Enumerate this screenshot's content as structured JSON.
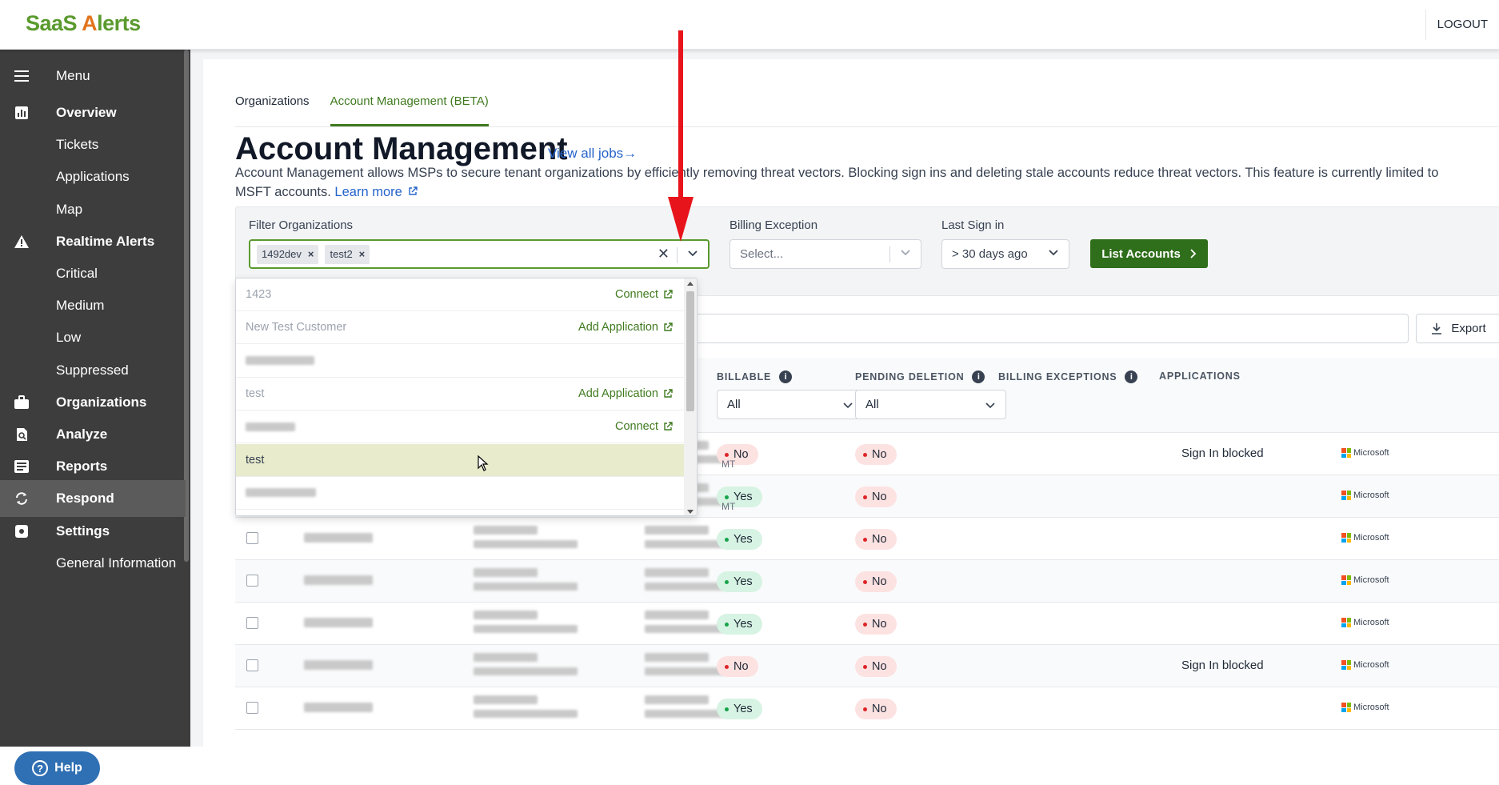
{
  "app": {
    "logo_text": "SaaS Alerts",
    "logo_prefix": "SaaS ",
    "logo_accent": "A",
    "logo_suffix": "lerts",
    "logout": "LOGOUT",
    "brand_color": "#5a9a2e",
    "accent_color": "#3f7a1e"
  },
  "sidebar": {
    "menu": "Menu",
    "items": [
      {
        "label": "Overview",
        "icon": "chart-icon",
        "bold": true
      },
      {
        "label": "Tickets",
        "icon": "",
        "bold": false
      },
      {
        "label": "Applications",
        "icon": "",
        "bold": false
      },
      {
        "label": "Map",
        "icon": "",
        "bold": false
      },
      {
        "label": "Realtime Alerts",
        "icon": "warning-icon",
        "bold": true
      },
      {
        "label": "Critical",
        "icon": "",
        "bold": false
      },
      {
        "label": "Medium",
        "icon": "",
        "bold": false
      },
      {
        "label": "Low",
        "icon": "",
        "bold": false
      },
      {
        "label": "Suppressed",
        "icon": "",
        "bold": false
      },
      {
        "label": "Organizations",
        "icon": "briefcase-icon",
        "bold": true
      },
      {
        "label": "Analyze",
        "icon": "analyze-icon",
        "bold": true
      },
      {
        "label": "Reports",
        "icon": "reports-icon",
        "bold": true
      },
      {
        "label": "Respond",
        "icon": "respond-icon",
        "bold": true,
        "active": true
      },
      {
        "label": "Settings",
        "icon": "gear-icon",
        "bold": true
      },
      {
        "label": "General Information",
        "icon": "",
        "bold": false
      }
    ],
    "help": "Help"
  },
  "tabs": [
    {
      "label": "Organizations",
      "active": false
    },
    {
      "label": "Account Management (BETA)",
      "active": true
    }
  ],
  "page": {
    "title": "Account Management",
    "view_jobs": "View all jobs→",
    "description": "Account Management allows MSPs to secure tenant organizations by efficiently removing threat vectors. Blocking sign ins and deleting stale accounts reduce threat vectors. This feature is currently limited to MSFT accounts.",
    "learn_more": "Learn more"
  },
  "filters": {
    "org_label": "Filter Organizations",
    "org_chips": [
      "1492dev",
      "test2"
    ],
    "billing_label": "Billing Exception",
    "billing_placeholder": "Select...",
    "last_sign_label": "Last Sign in",
    "last_sign_value": "> 30 days ago",
    "list_button": "List Accounts"
  },
  "dropdown_options": [
    {
      "label": "1423",
      "action": "Connect",
      "blurred": false,
      "highlight": false
    },
    {
      "label": "New Test Customer",
      "action": "Add Application",
      "blurred": false,
      "highlight": false
    },
    {
      "label": "",
      "action": "",
      "blurred": true,
      "highlight": false
    },
    {
      "label": "test",
      "action": "Add Application",
      "blurred": false,
      "highlight": false
    },
    {
      "label": "",
      "action": "Connect",
      "blurred": true,
      "highlight": false
    },
    {
      "label": "test",
      "action": "",
      "blurred": false,
      "highlight": true
    },
    {
      "label": "",
      "action": "",
      "blurred": true,
      "highlight": false
    }
  ],
  "toolbar": {
    "export": "Export"
  },
  "table": {
    "headers": {
      "billable": "BILLABLE",
      "pending_deletion": "PENDING DELETION",
      "billing_exceptions": "BILLING EXCEPTIONS",
      "applications": "APPLICATIONS"
    },
    "billable_filter": "All",
    "pending_filter": "All",
    "rows": [
      {
        "billable": "No",
        "pending": "No",
        "exception": "Sign In blocked",
        "app": "Microsoft"
      },
      {
        "billable": "Yes",
        "pending": "No",
        "exception": "",
        "app": "Microsoft"
      },
      {
        "billable": "Yes",
        "pending": "No",
        "exception": "",
        "app": "Microsoft"
      },
      {
        "billable": "Yes",
        "pending": "No",
        "exception": "",
        "app": "Microsoft"
      },
      {
        "billable": "Yes",
        "pending": "No",
        "exception": "",
        "app": "Microsoft"
      },
      {
        "billable": "No",
        "pending": "No",
        "exception": "Sign In blocked",
        "app": "Microsoft"
      },
      {
        "billable": "Yes",
        "pending": "No",
        "exception": "",
        "app": "Microsoft"
      }
    ],
    "partial_suffix": "MT"
  }
}
